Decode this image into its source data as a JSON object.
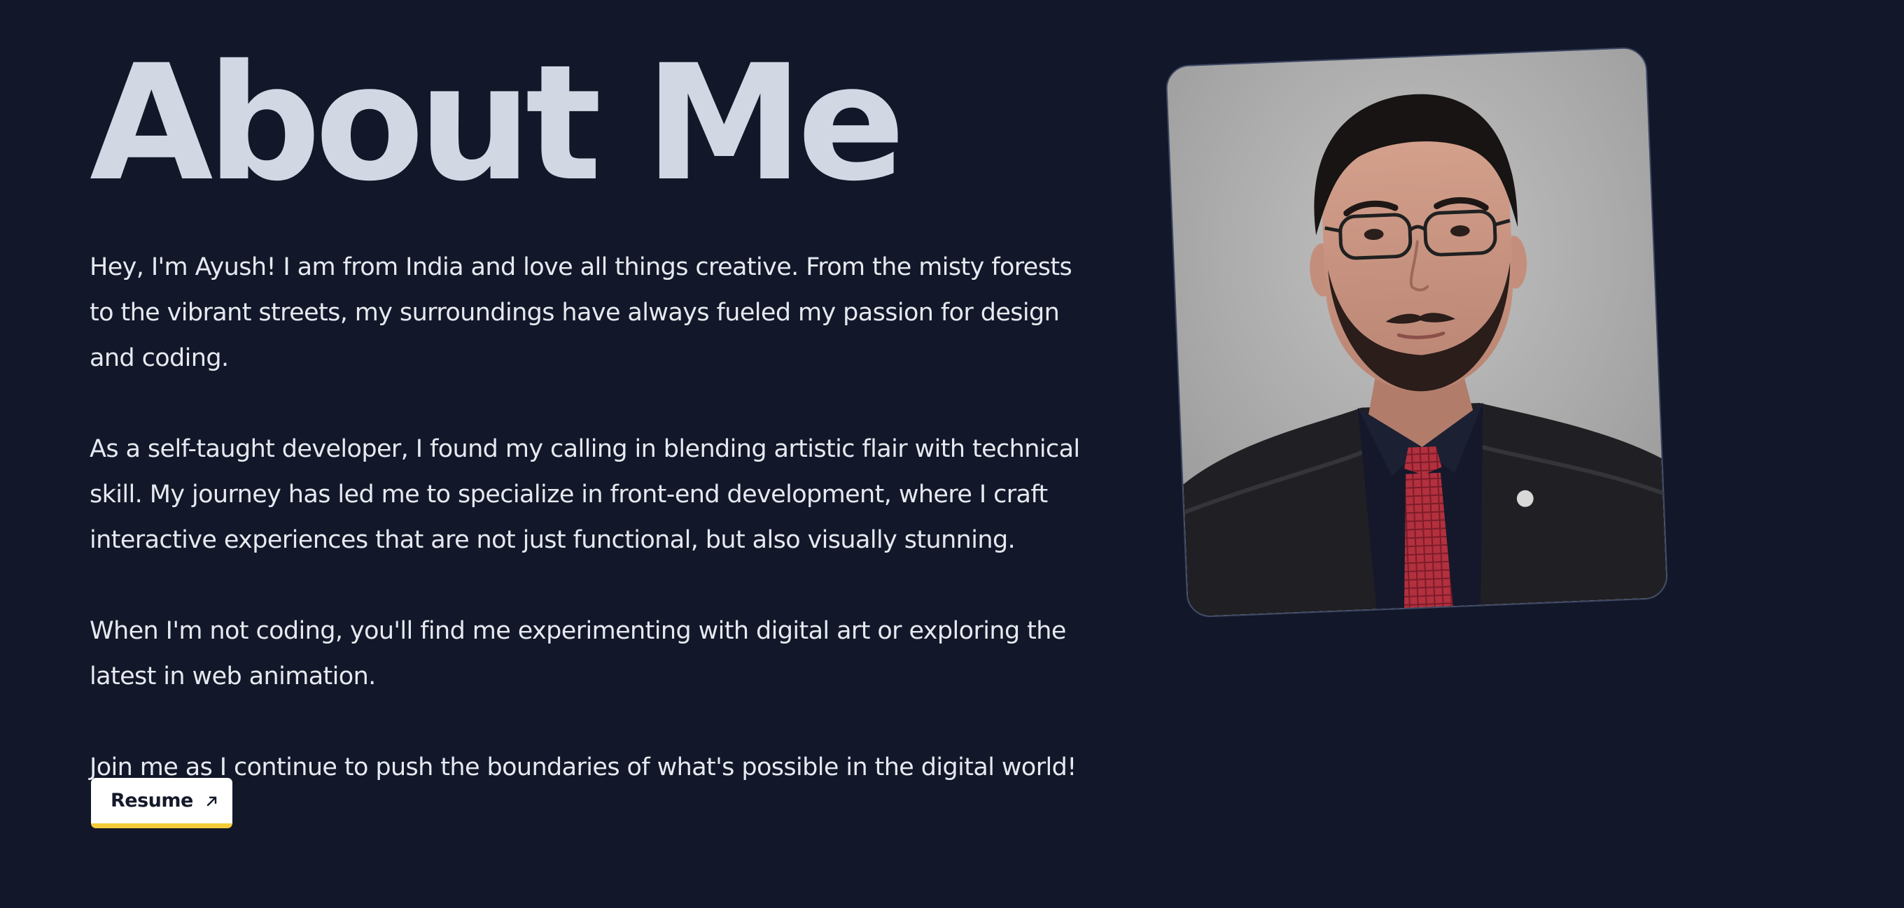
{
  "about": {
    "title": "About Me",
    "paragraphs": [
      "Hey, I'm Ayush! I am from India and love all things creative. From the misty forests to the vibrant streets, my surroundings have always fueled my passion for design and coding.",
      "As a self-taught developer, I found my calling in blending artistic flair with technical skill. My journey has led me to specialize in front-end development, where I craft interactive experiences that are not just functional, but also visually stunning.",
      "When I'm not coding, you'll find me experimenting with digital art or exploring the latest in web animation.",
      "Join me as I continue to push the boundaries of what's possible in the digital world!"
    ],
    "resume_label": "Resume",
    "resume_icon": "arrow-up-right-icon",
    "profile_photo": "profile-portrait"
  },
  "colors": {
    "background": "#121729",
    "title": "#d1d8e4",
    "text": "#e6e9ef",
    "button_bg": "#ffffff",
    "button_accent": "#f4cc3a",
    "button_text": "#141a2b"
  }
}
